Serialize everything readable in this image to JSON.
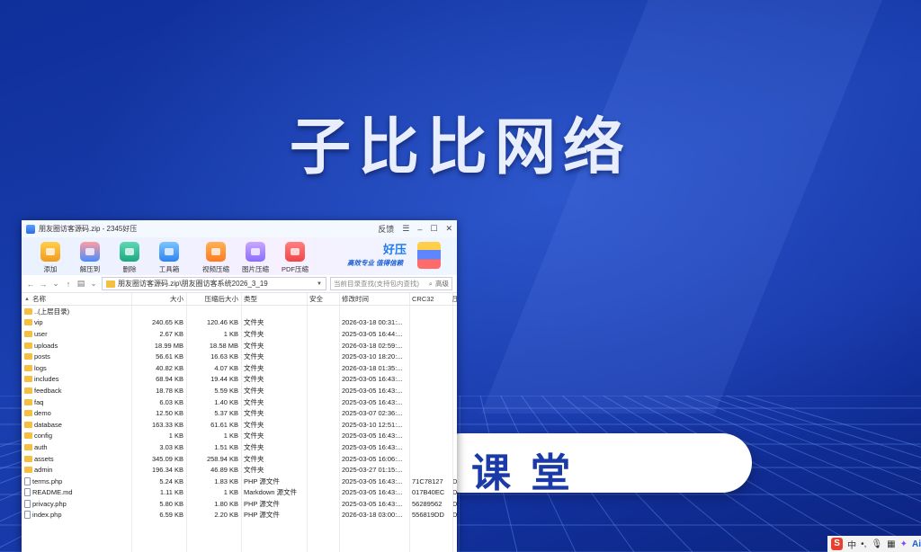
{
  "background": {
    "title": "子比比网络",
    "pill_text": "课堂"
  },
  "window": {
    "title": "朋友圈访客源码.zip - 2345好压",
    "feedback": "反馈"
  },
  "toolbar": {
    "buttons": [
      {
        "label": "添加",
        "icon": "add-archive-icon"
      },
      {
        "label": "解压到",
        "icon": "extract-icon"
      },
      {
        "label": "删除",
        "icon": "recycle-icon"
      },
      {
        "label": "工具箱",
        "icon": "toolbox-icon"
      },
      {
        "label": "视频压缩",
        "icon": "video-compress-icon"
      },
      {
        "label": "图片压缩",
        "icon": "image-compress-icon"
      },
      {
        "label": "PDF压缩",
        "icon": "pdf-compress-icon"
      }
    ],
    "promo_brand": "好压",
    "promo_slogan": "高效专业 值得信赖"
  },
  "address": {
    "path": "朋友圈访客源码.zip\\朋友圈访客系统2026_3_19",
    "search_placeholder": "当前目录查找(支持包内查找)",
    "search_button": "高级"
  },
  "table": {
    "columns": [
      "名称",
      "大小",
      "压缩后大小",
      "类型",
      "安全",
      "修改时间",
      "CRC32",
      "压"
    ],
    "rows": [
      {
        "icon": "up",
        "name": "..(上层目录)",
        "size": "",
        "csize": "",
        "type": "",
        "sec": "",
        "mtime": "",
        "crc": "",
        "last": ""
      },
      {
        "icon": "folder",
        "name": "vip",
        "size": "240.65 KB",
        "csize": "120.46 KB",
        "type": "文件夹",
        "sec": "",
        "mtime": "2026-03-18 00:31:...",
        "crc": "",
        "last": ""
      },
      {
        "icon": "folder",
        "name": "user",
        "size": "2.67 KB",
        "csize": "1 KB",
        "type": "文件夹",
        "sec": "",
        "mtime": "2025-03-05 16:44:...",
        "crc": "",
        "last": ""
      },
      {
        "icon": "folder",
        "name": "uploads",
        "size": "18.99 MB",
        "csize": "18.58 MB",
        "type": "文件夹",
        "sec": "",
        "mtime": "2026-03-18 02:59:...",
        "crc": "",
        "last": ""
      },
      {
        "icon": "folder",
        "name": "posts",
        "size": "56.61 KB",
        "csize": "16.63 KB",
        "type": "文件夹",
        "sec": "",
        "mtime": "2025-03-10 18:20:...",
        "crc": "",
        "last": ""
      },
      {
        "icon": "folder",
        "name": "logs",
        "size": "40.82 KB",
        "csize": "4.07 KB",
        "type": "文件夹",
        "sec": "",
        "mtime": "2026-03-18 01:35:...",
        "crc": "",
        "last": ""
      },
      {
        "icon": "folder",
        "name": "includes",
        "size": "68.94 KB",
        "csize": "19.44 KB",
        "type": "文件夹",
        "sec": "",
        "mtime": "2025-03-05 16:43:...",
        "crc": "",
        "last": ""
      },
      {
        "icon": "folder",
        "name": "feedback",
        "size": "18.78 KB",
        "csize": "5.59 KB",
        "type": "文件夹",
        "sec": "",
        "mtime": "2025-03-05 16:43:...",
        "crc": "",
        "last": ""
      },
      {
        "icon": "folder",
        "name": "faq",
        "size": "6.03 KB",
        "csize": "1.40 KB",
        "type": "文件夹",
        "sec": "",
        "mtime": "2025-03-05 16:43:...",
        "crc": "",
        "last": ""
      },
      {
        "icon": "folder",
        "name": "demo",
        "size": "12.50 KB",
        "csize": "5.37 KB",
        "type": "文件夹",
        "sec": "",
        "mtime": "2025-03-07 02:36:...",
        "crc": "",
        "last": ""
      },
      {
        "icon": "folder",
        "name": "database",
        "size": "163.33 KB",
        "csize": "61.61 KB",
        "type": "文件夹",
        "sec": "",
        "mtime": "2025-03-10 12:51:...",
        "crc": "",
        "last": ""
      },
      {
        "icon": "folder",
        "name": "config",
        "size": "1 KB",
        "csize": "1 KB",
        "type": "文件夹",
        "sec": "",
        "mtime": "2025-03-05 16:43:...",
        "crc": "",
        "last": ""
      },
      {
        "icon": "folder",
        "name": "auth",
        "size": "3.03 KB",
        "csize": "1.51 KB",
        "type": "文件夹",
        "sec": "",
        "mtime": "2025-03-05 16:43:...",
        "crc": "",
        "last": ""
      },
      {
        "icon": "folder",
        "name": "assets",
        "size": "345.09 KB",
        "csize": "258.94 KB",
        "type": "文件夹",
        "sec": "",
        "mtime": "2025-03-05 16:06:...",
        "crc": "",
        "last": ""
      },
      {
        "icon": "folder",
        "name": "admin",
        "size": "196.34 KB",
        "csize": "46.89 KB",
        "type": "文件夹",
        "sec": "",
        "mtime": "2025-03-27 01:15:...",
        "crc": "",
        "last": ""
      },
      {
        "icon": "file",
        "name": "terms.php",
        "size": "5.24 KB",
        "csize": "1.83 KB",
        "type": "PHP 源文件",
        "sec": "",
        "mtime": "2025-03-05 16:43:...",
        "crc": "71C78127",
        "last": "D"
      },
      {
        "icon": "file",
        "name": "README.md",
        "size": "1.11 KB",
        "csize": "1 KB",
        "type": "Markdown 源文件",
        "sec": "",
        "mtime": "2025-03-05 16:43:...",
        "crc": "017B40EC",
        "last": "D"
      },
      {
        "icon": "file",
        "name": "privacy.php",
        "size": "5.80 KB",
        "csize": "1.80 KB",
        "type": "PHP 源文件",
        "sec": "",
        "mtime": "2025-03-05 16:43:...",
        "crc": "56289562",
        "last": "D"
      },
      {
        "icon": "file",
        "name": "index.php",
        "size": "6.59 KB",
        "csize": "2.20 KB",
        "type": "PHP 源文件",
        "sec": "",
        "mtime": "2026-03-18 03:00:...",
        "crc": "556819DD",
        "last": "D"
      }
    ]
  },
  "tray": {
    "ime_label": "中",
    "punct_label": "•,",
    "ai_label": "Ai"
  }
}
